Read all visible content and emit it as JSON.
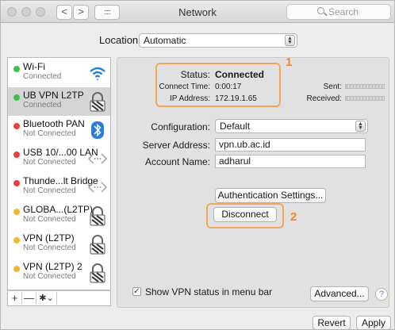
{
  "window": {
    "title": "Network",
    "search_placeholder": "Search"
  },
  "toolbar": {
    "back": "<",
    "forward": ">",
    "grid": ":::::"
  },
  "location": {
    "label": "Location:",
    "value": "Automatic"
  },
  "sidebar": {
    "items": [
      {
        "name": "Wi-Fi",
        "status": "Connected",
        "dot": "#3cc24a",
        "icon": "wifi-icon"
      },
      {
        "name": "UB VPN L2TP",
        "status": "Connected",
        "dot": "#3cc24a",
        "icon": "lock-icon"
      },
      {
        "name": "Bluetooth PAN",
        "status": "Not Connected",
        "dot": "#e8423c",
        "icon": "bluetooth-icon"
      },
      {
        "name": "USB 10/...00 LAN",
        "status": "Not Connected",
        "dot": "#e8423c",
        "icon": "ethernet-icon"
      },
      {
        "name": "Thunde...lt Bridge",
        "status": "Not Connected",
        "dot": "#e8423c",
        "icon": "ethernet-icon"
      },
      {
        "name": "GLOBA...(L2TP)",
        "status": "Not Connected",
        "dot": "#f5b52e",
        "icon": "lock-icon"
      },
      {
        "name": "VPN (L2TP)",
        "status": "Not Connected",
        "dot": "#f5b52e",
        "icon": "lock-icon"
      },
      {
        "name": "VPN (L2TP) 2",
        "status": "Not Connected",
        "dot": "#f5b52e",
        "icon": "lock-icon"
      }
    ],
    "tools": {
      "add": "+",
      "remove": "—",
      "action": "✱⌄"
    }
  },
  "status": {
    "label": "Status:",
    "value": "Connected",
    "connect_time_label": "Connect Time:",
    "connect_time": "0:00:17",
    "ip_label": "IP Address:",
    "ip": "172.19.1.65",
    "sent_label": "Sent:",
    "received_label": "Received:"
  },
  "form": {
    "configuration_label": "Configuration:",
    "configuration": "Default",
    "server_label": "Server Address:",
    "server": "vpn.ub.ac.id",
    "account_label": "Account Name:",
    "account": "adharul"
  },
  "buttons": {
    "auth": "Authentication Settings...",
    "disconnect": "Disconnect",
    "advanced": "Advanced...",
    "help": "?",
    "revert": "Revert",
    "apply": "Apply"
  },
  "checkbox": {
    "label": "Show VPN status in menu bar",
    "checked": true
  },
  "annotations": {
    "one": "1",
    "two": "2"
  },
  "colors": {
    "accent_orange": "#f08a24",
    "connected_green": "#3cc24a",
    "error_red": "#e8423c",
    "warning_yellow": "#f5b52e"
  }
}
